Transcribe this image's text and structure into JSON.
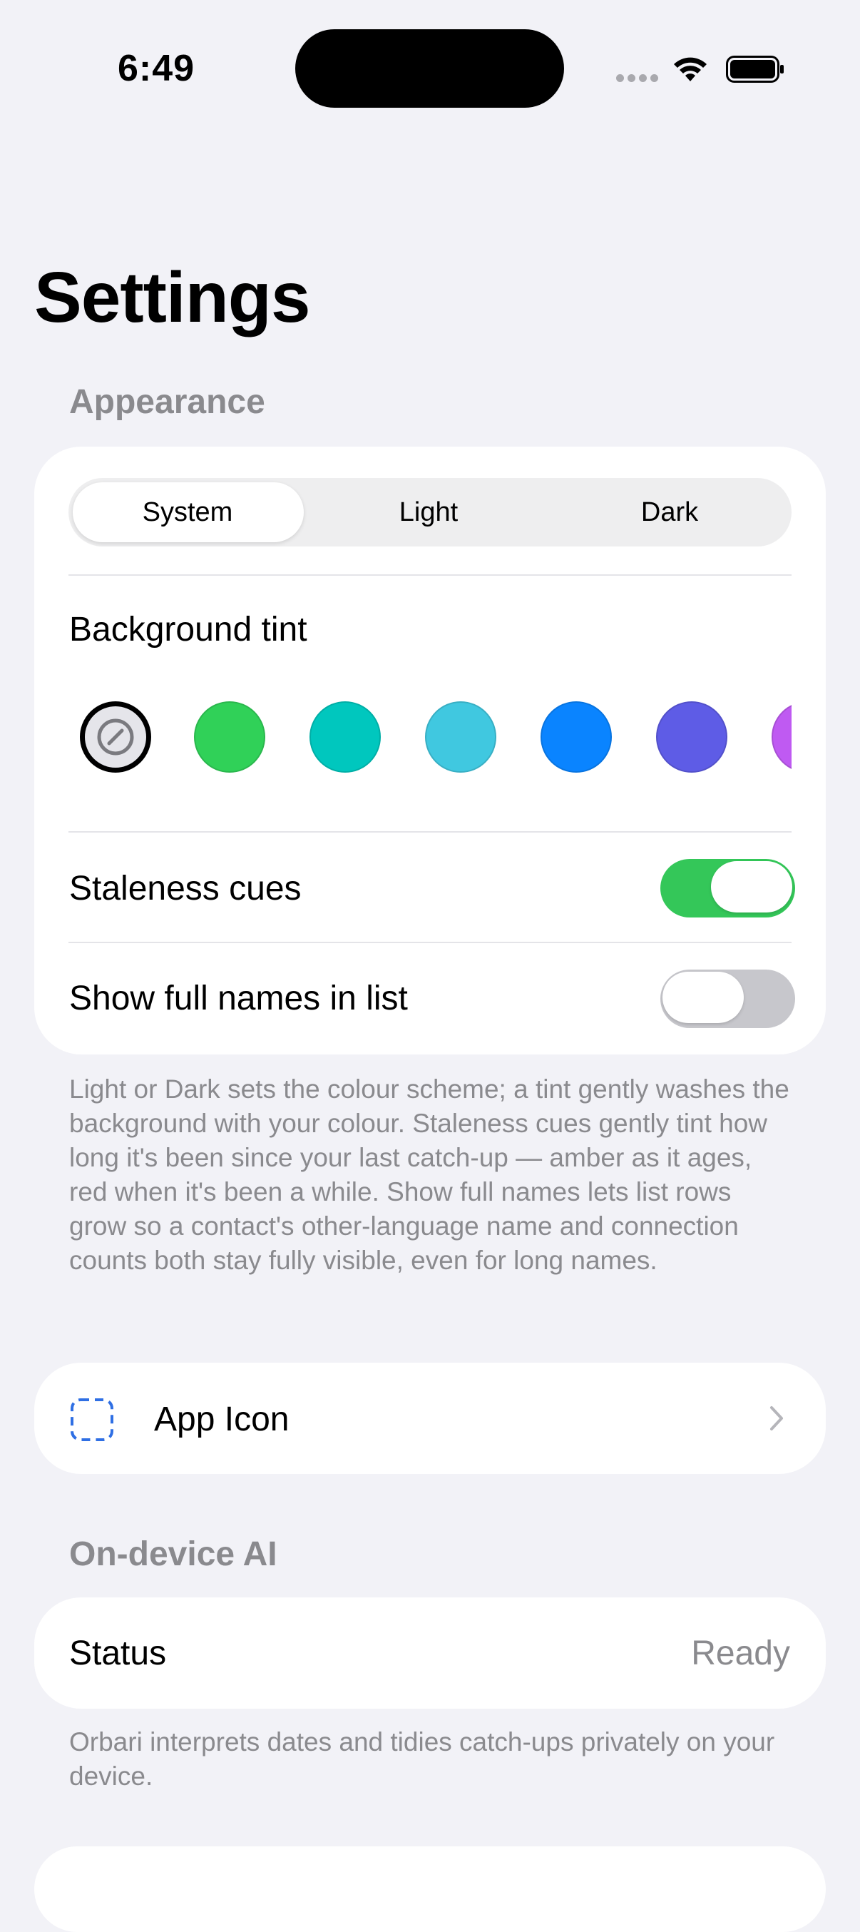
{
  "status_bar": {
    "time": "6:49"
  },
  "page": {
    "title": "Settings"
  },
  "appearance": {
    "header": "Appearance",
    "segments": [
      "System",
      "Light",
      "Dark"
    ],
    "selected_segment": "System",
    "tint_label": "Background tint",
    "tint_swatches": [
      "#30D158",
      "#00C7BE",
      "#40C8E0",
      "#0A84FF",
      "#5E5CE6",
      "#BF5AF2"
    ],
    "tint_selected": "none",
    "staleness_label": "Staleness cues",
    "staleness_on": true,
    "fullnames_label": "Show full names in list",
    "fullnames_on": false,
    "footnote": "Light or Dark sets the colour scheme; a tint gently washes the background with your colour. Staleness cues gently tint how long it's been since your last catch-up — amber as it ages, red when it's been a while. Show full names lets list rows grow so a contact's other-language name and connection counts both stay fully visible, even for long names."
  },
  "app_icon": {
    "label": "App Icon",
    "icon": "dashed-square-icon"
  },
  "ai": {
    "header": "On-device AI",
    "status_label": "Status",
    "status_value": "Ready",
    "footnote": "Orbari interprets dates and tidies catch-ups privately on your device."
  },
  "colors": {
    "accent_green": "#34C759",
    "accent_blue": "#2F6FE4"
  }
}
